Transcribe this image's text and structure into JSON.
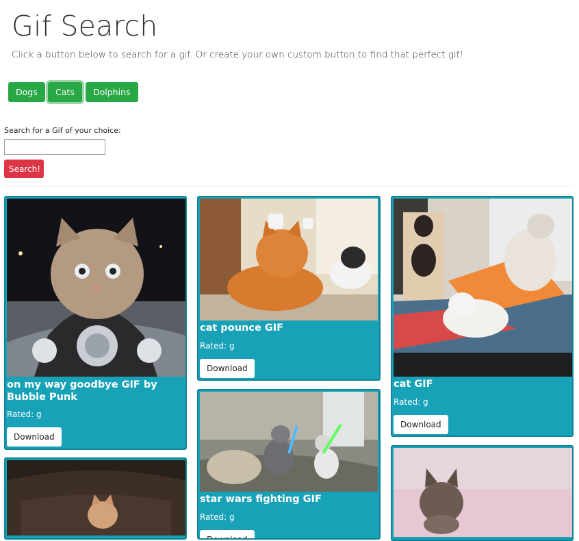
{
  "header": {
    "title": "Gif Search",
    "subtitle": "Click a button below to search for a gif. Or create your own custom button to find that perfect gif!"
  },
  "topics": [
    {
      "label": "Dogs",
      "active": false
    },
    {
      "label": "Cats",
      "active": true
    },
    {
      "label": "Dolphins",
      "active": false
    }
  ],
  "search": {
    "label": "Search for a Gif of your choice:",
    "value": "",
    "placeholder": "",
    "button_label": "Search!"
  },
  "colors": {
    "topic_button": "#28a745",
    "search_button": "#dc3545",
    "card_bg": "#17a2b8"
  },
  "gifs": [
    {
      "title": "on my way goodbye GIF by Bubble Punk",
      "rating": "Rated: g",
      "download_label": "Download",
      "image": "kitten-on-motorcycle"
    },
    {
      "title": "",
      "rating": "",
      "download_label": "",
      "image": "kitten-on-leather-couch"
    },
    {
      "title": "cat pounce GIF",
      "rating": "Rated: g",
      "download_label": "Download",
      "image": "cats-with-hats"
    },
    {
      "title": "star wars fighting GIF",
      "rating": "Rated: g",
      "download_label": "Download",
      "image": "cats-lightsaber-fight"
    },
    {
      "title": "cat GIF",
      "rating": "Rated: g",
      "download_label": "Download",
      "image": "kittens-playing"
    },
    {
      "title": "",
      "rating": "",
      "download_label": "",
      "image": "kitten-on-pink"
    }
  ]
}
